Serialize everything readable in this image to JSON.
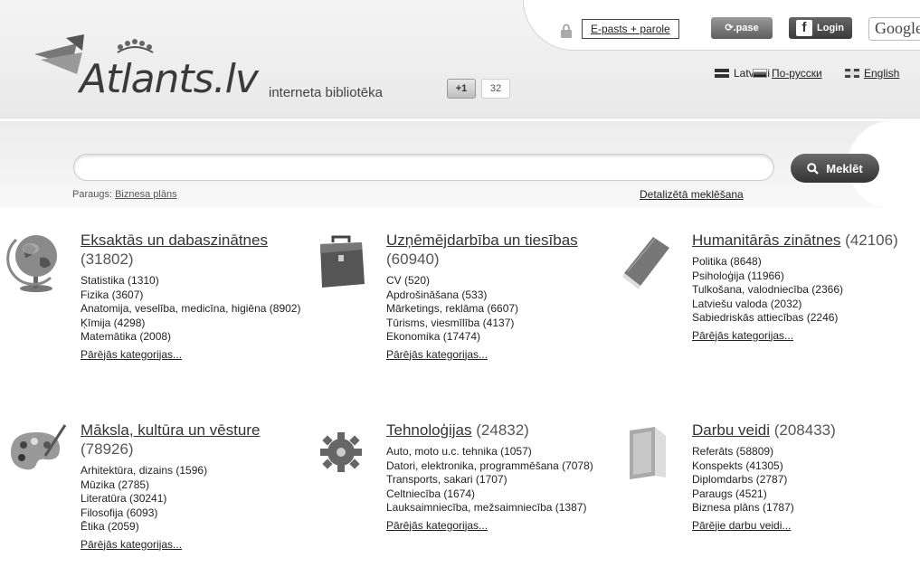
{
  "header": {
    "login_label": "E-pasts + parole",
    "pase_label": ".pase",
    "facebook_label": "Login",
    "google_label": "Google",
    "logo_text": "Atlants.lv",
    "tagline": "interneta bibliotēka",
    "gplus_label": "+1",
    "gplus_count": "32",
    "languages": [
      "Latviski",
      "По-русски",
      "English"
    ]
  },
  "search": {
    "input_value": "",
    "button_label": "Meklēt",
    "example_prefix": "Paraugs:",
    "example_link": "Biznesa plāns",
    "advanced_label": "Detalizētā meklēšana"
  },
  "categories": [
    {
      "title": "Eksaktās un dabaszinātnes",
      "count": "(31802)",
      "items": [
        "Statistika (1310)",
        "Fizika (3607)",
        "Anatomija, veselība, medicīna, higiēna (8902)",
        "Ķīmija (4298)",
        "Matemātika (2008)"
      ],
      "more": "Pārējās kategorijas...",
      "icon": "globe-icon"
    },
    {
      "title": "Uzņēmējdarbība un tiesības",
      "count": "(60940)",
      "items": [
        "CV (520)",
        "Apdrošināšana (533)",
        "Mārketings, reklāma (6607)",
        "Tūrisms, viesmīlība (4137)",
        "Ekonomika (17474)"
      ],
      "more": "Pārējās kategorijas...",
      "icon": "briefcase-icon"
    },
    {
      "title": "Humanitārās zinātnes",
      "count": "(42106)",
      "items": [
        "Politika (8648)",
        "Psiholoģija (11966)",
        "Tulkošana, valodniecība (2366)",
        "Latviešu valoda (2032)",
        "Sabiedriskās attiecības (2246)"
      ],
      "more": "Pārējās kategorijas...",
      "icon": "book-icon"
    },
    {
      "title": "Māksla, kultūra un vēsture",
      "count": "(78926)",
      "items": [
        "Arhitektūra, dizains (1596)",
        "Mūzika (2785)",
        "Literatūra (30241)",
        "Filosofija (6093)",
        "Ētika (2059)"
      ],
      "more": "Pārējās kategorijas...",
      "icon": "palette-icon"
    },
    {
      "title": "Tehnoloģijas",
      "count": "(24832)",
      "items": [
        "Auto, moto u.c. tehnika (1057)",
        "Datori, elektronika, programmēšana (7078)",
        "Transports, sakari (1707)",
        "Celtniecība (1674)",
        "Lauksaimniecība, mežsaimniecība (1387)"
      ],
      "more": "Pārējās kategorijas...",
      "icon": "gear-icon"
    },
    {
      "title": "Darbu veidi",
      "count": "(208433)",
      "items": [
        "Referāts (58809)",
        "Konspekts (41305)",
        "Diplomdarbs (2787)",
        "Paraugs (4521)",
        "Biznesa plāns (1787)"
      ],
      "more": "Pārējie darbu veidi...",
      "icon": "folder-icon"
    }
  ]
}
